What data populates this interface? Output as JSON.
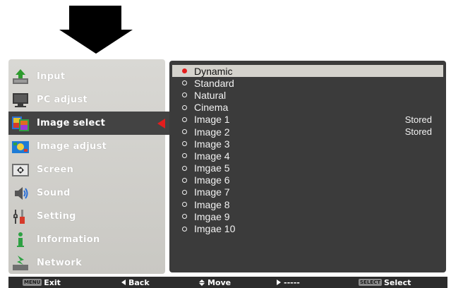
{
  "menu": {
    "items": [
      {
        "label": "Input",
        "icon": "input-icon"
      },
      {
        "label": "PC adjust",
        "icon": "pc-adjust-icon"
      },
      {
        "label": "Image select",
        "icon": "image-select-icon"
      },
      {
        "label": "Image adjust",
        "icon": "image-adjust-icon"
      },
      {
        "label": "Screen",
        "icon": "screen-icon"
      },
      {
        "label": "Sound",
        "icon": "sound-icon"
      },
      {
        "label": "Setting",
        "icon": "setting-icon"
      },
      {
        "label": "Information",
        "icon": "information-icon"
      },
      {
        "label": "Network",
        "icon": "network-icon"
      }
    ],
    "selected_index": 2
  },
  "panel": {
    "options": [
      {
        "label": "Dynamic",
        "status": ""
      },
      {
        "label": "Standard",
        "status": ""
      },
      {
        "label": "Natural",
        "status": ""
      },
      {
        "label": "Cinema",
        "status": ""
      },
      {
        "label": "Image 1",
        "status": "Stored"
      },
      {
        "label": "Image 2",
        "status": "Stored"
      },
      {
        "label": "Image 3",
        "status": ""
      },
      {
        "label": "Image 4",
        "status": ""
      },
      {
        "label": "Imgae 5",
        "status": ""
      },
      {
        "label": "Image 6",
        "status": ""
      },
      {
        "label": "Image 7",
        "status": ""
      },
      {
        "label": "Image 8",
        "status": ""
      },
      {
        "label": "Imgae 9",
        "status": ""
      },
      {
        "label": "Imgae 10",
        "status": ""
      }
    ],
    "highlighted_index": 0
  },
  "bottom_bar": {
    "menu_badge": "MENU",
    "exit_label": "Exit",
    "back_label": "Back",
    "move_label": "Move",
    "next_label": "-----",
    "select_badge": "SELECT",
    "select_label": "Select"
  },
  "colors": {
    "accent_red": "#e51d1d",
    "panel_bg": "#3b3b3b",
    "menu_bg": "#d2d1cc",
    "highlight_bg": "#d4d2cc"
  }
}
